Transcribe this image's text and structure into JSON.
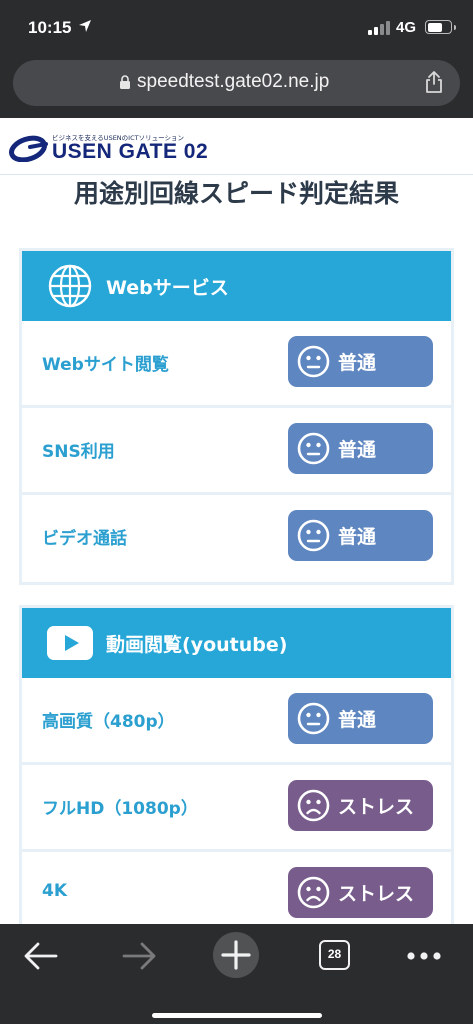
{
  "status_bar": {
    "time": "10:15",
    "network": "4G"
  },
  "browser": {
    "url": "speedtest.gate02.ne.jp",
    "tab_count": "28"
  },
  "logo": {
    "tagline": "ビジネスを支えるUSENのICTソリューション",
    "name": "USEN GATE 02"
  },
  "page_title": "用途別回線スピード判定結果",
  "sections": [
    {
      "title": "Webサービス",
      "icon": "globe-icon",
      "rows": [
        {
          "label": "Webサイト閲覧",
          "result": "普通"
        },
        {
          "label": "SNS利用",
          "result": "普通"
        },
        {
          "label": "ビデオ通話",
          "result": "普通"
        }
      ]
    },
    {
      "title": "動画閲覧(youtube)",
      "icon": "video-play-icon",
      "rows": [
        {
          "label": "高画質（480p）",
          "result": "普通"
        },
        {
          "label": "フルHD（1080p）",
          "result": "ストレス"
        },
        {
          "label": "4K",
          "result": "ストレス"
        }
      ]
    }
  ],
  "colors": {
    "section_header": "#26a7d7",
    "badge_normal": "#5e86c0",
    "badge_stress": "#785d8c",
    "label_text": "#2a9fd0",
    "title_text": "#2d3a4a"
  }
}
